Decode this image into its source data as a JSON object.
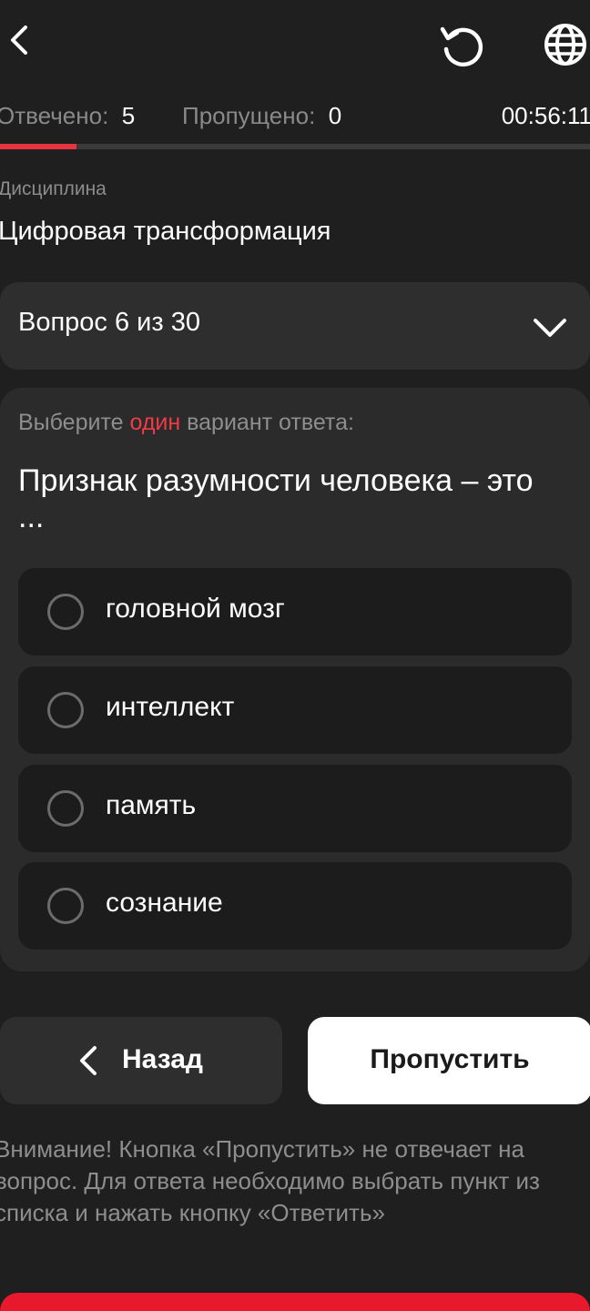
{
  "header": {
    "back_icon": "chevron-left-icon",
    "reset_icon": "restart-icon",
    "language_icon": "globe-icon"
  },
  "stats": {
    "answered_label": "Отвечено:",
    "answered_value": "5",
    "skipped_label": "Пропущено:",
    "skipped_value": "0",
    "timer": "00:56:11"
  },
  "progress": {
    "fraction": 0.13,
    "color": "#e8343f"
  },
  "discipline": {
    "label": "Дисциплина",
    "value": "Цифровая трансформация"
  },
  "question_selector": {
    "label": "Вопрос 6 из 30",
    "icon": "chevron-down-icon"
  },
  "question": {
    "hint_prefix": "Выберите ",
    "hint_accent": "один",
    "hint_suffix": " вариант ответа:",
    "text": "Признак разумности человека – это ...",
    "options": [
      {
        "label": "головной мозг",
        "selected": false
      },
      {
        "label": "интеллект",
        "selected": false
      },
      {
        "label": "память",
        "selected": false
      },
      {
        "label": "сознание",
        "selected": false
      }
    ]
  },
  "actions": {
    "back_label": "Назад",
    "skip_label": "Пропустить"
  },
  "notice": "Внимание! Кнопка «Пропустить» не отвечает на вопрос. Для ответа необходимо выбрать пункт из списка и нажать кнопку «Ответить»",
  "colors": {
    "background": "#1f1f1f",
    "accent": "#ef3b45",
    "answer_button": "#e8192c"
  }
}
